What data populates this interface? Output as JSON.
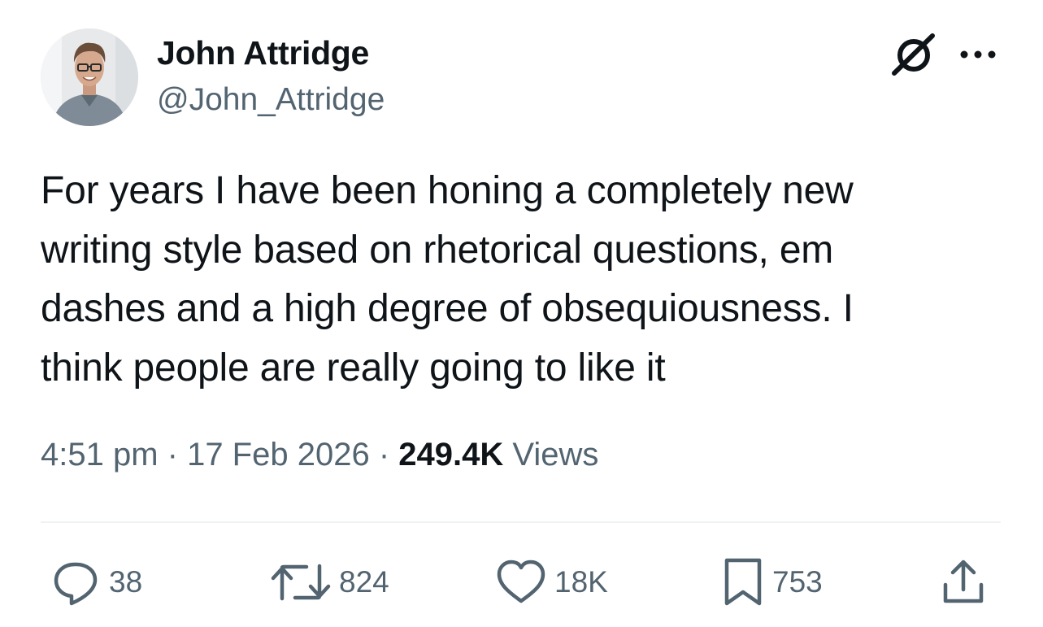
{
  "author": {
    "display_name": "John Attridge",
    "handle": "@John_Attridge"
  },
  "header_icons": [
    "grok-icon",
    "more-options-icon"
  ],
  "tweet": {
    "text_lines": [
      "For years I have been honing a completely new",
      "writing style based on rhetorical questions, em",
      "dashes and a high degree of obsequiousness. I",
      "think people are really going to like it"
    ]
  },
  "meta": {
    "time": "4:51 pm",
    "separator": " · ",
    "date": "17 Feb 2026",
    "views_count": "249.4K",
    "views_label": " Views"
  },
  "actions": {
    "replies": "38",
    "reposts": "824",
    "likes": "18K",
    "bookmarks": "753"
  },
  "colors": {
    "text_primary": "#0f1419",
    "text_secondary": "#536471",
    "divider": "#eff3f4",
    "background": "#ffffff"
  }
}
